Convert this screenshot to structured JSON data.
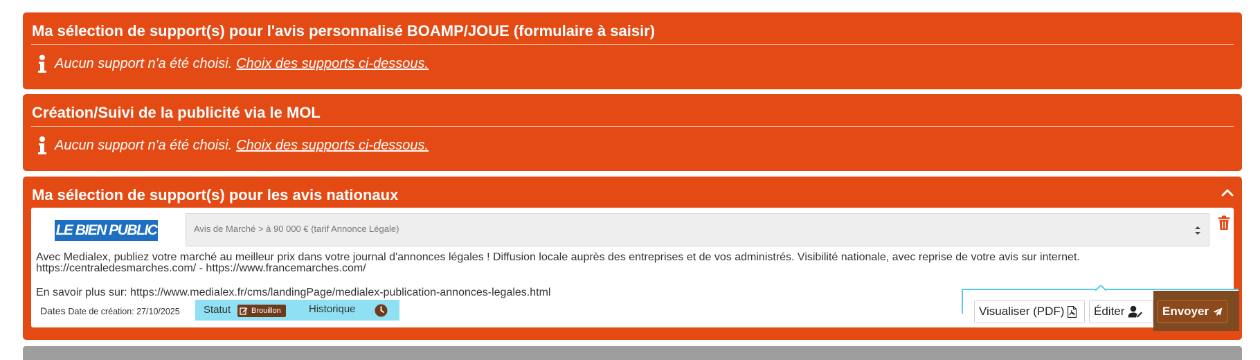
{
  "colors": {
    "panel_bg": "#e44a14",
    "status_bg": "#90e0f4",
    "badge_bg": "#6e3a1a",
    "send_bg": "#8c4a1c",
    "logo_bg": "#1c6fc1"
  },
  "panels": [
    {
      "title": "Ma sélection de support(s) pour l'avis personnalisé BOAMP/JOUE (formulaire à saisir)",
      "info_text": "Aucun support n'a été choisi.",
      "info_link": "Choix des supports ci-dessous.",
      "icon": "info-icon"
    },
    {
      "title": "Création/Suivi de la publicité via le MOL",
      "info_text": "Aucun support n'a été choisi.",
      "info_link": "Choix des supports ci-dessous.",
      "icon": "info-icon"
    },
    {
      "title": "Ma sélection de support(s) pour les avis nationaux",
      "collapse_icon": "chevron-up-icon",
      "support": {
        "logo_text": "LE BIEN PUBLIC",
        "select_value": "Avis de Marché > à 90 000 € (tarif Annonce Légale)",
        "description_line1": "Avec Medialex, publiez votre marché au meilleur prix dans votre journal d'annonces légales ! Diffusion locale auprès des entreprises et de vos administrés. Visibilité nationale, avec reprise de votre avis sur internet.",
        "description_line2": "https://centraledesmarches.com/ - https://www.francemarches.com/",
        "more_info": "En savoir plus sur: https://www.medialex.fr/cms/landingPage/medialex-publication-annonces-legales.html",
        "dates_label": "Dates",
        "creation_date": "Date de création: 27/10/2025",
        "status_label": "Statut",
        "status_value": "Brouillon",
        "history_label": "Historique",
        "actions": {
          "preview": "Visualiser (PDF)",
          "edit": "Éditer",
          "send": "Envoyer"
        }
      }
    }
  ]
}
